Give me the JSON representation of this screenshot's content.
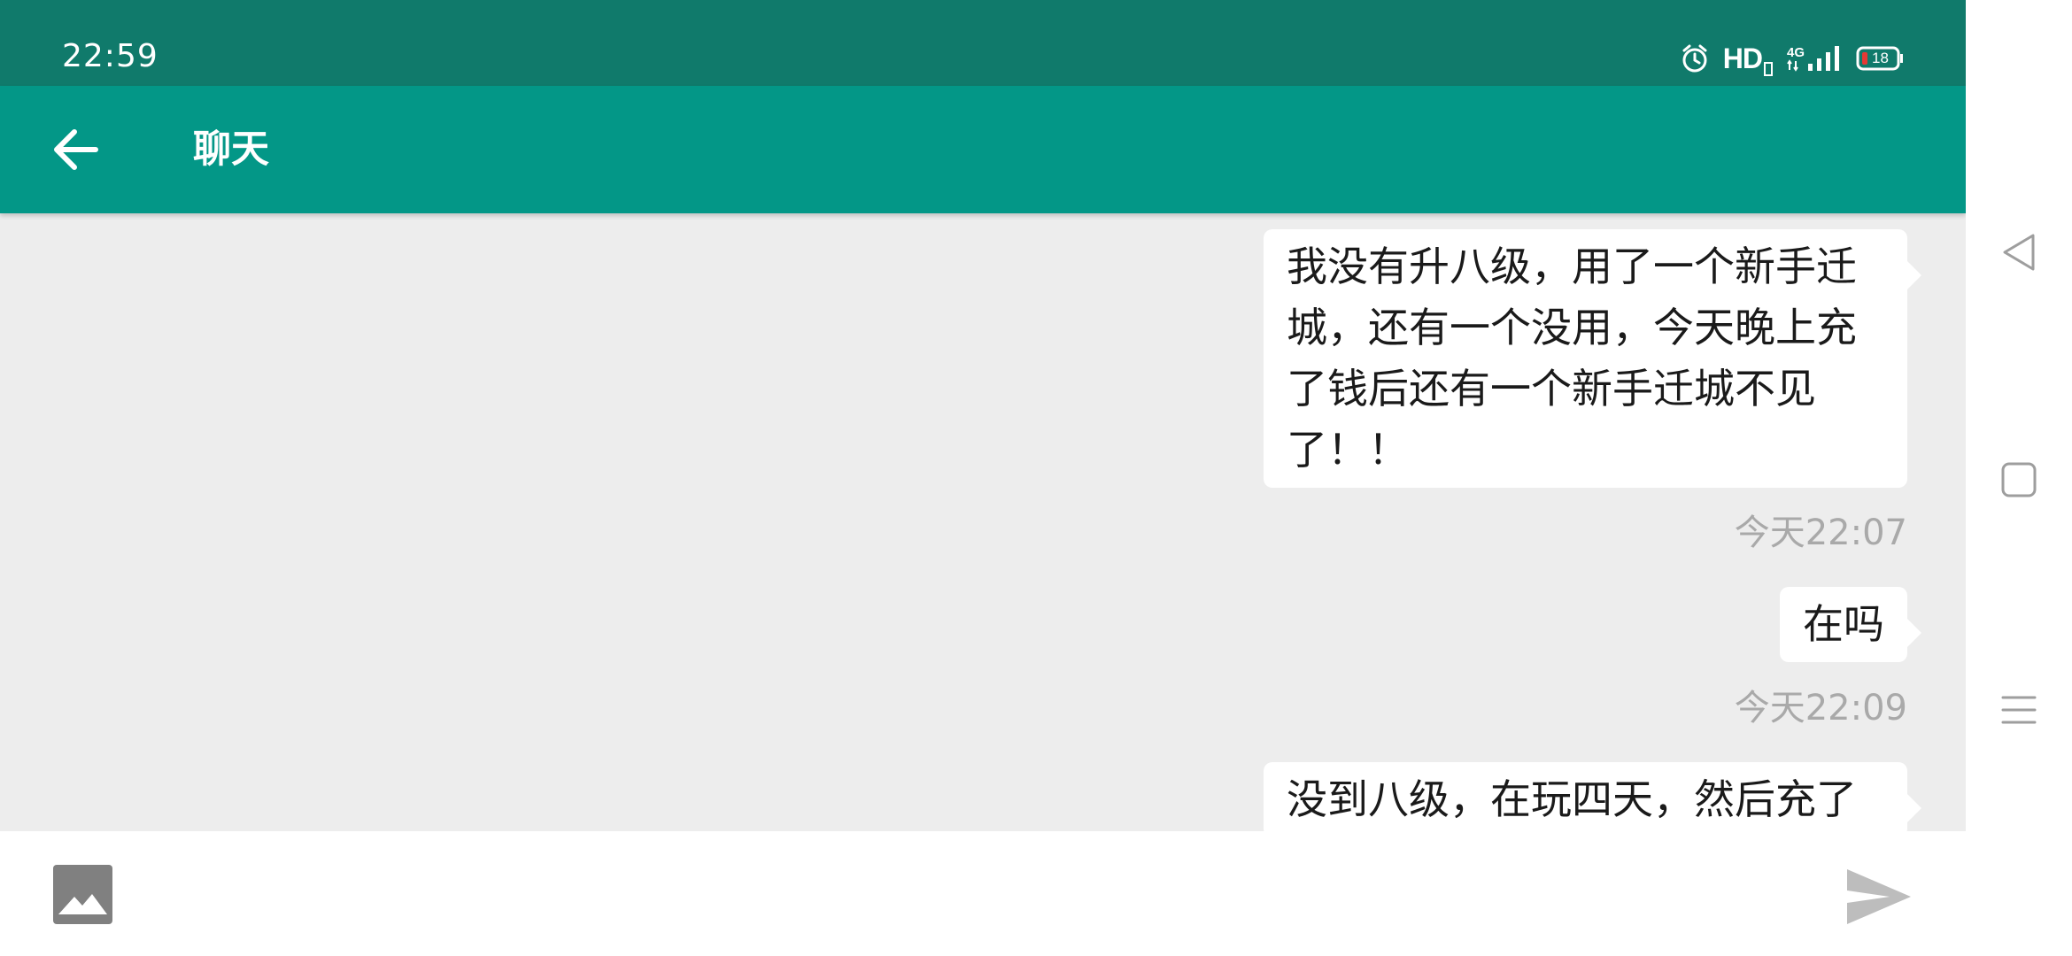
{
  "status_bar": {
    "time": "22:59",
    "hd": "HD",
    "network": "4G",
    "battery": "18",
    "icons": [
      "alarm-icon",
      "hd-icon",
      "signal-4g-icon",
      "battery-icon"
    ]
  },
  "app_bar": {
    "title": "聊天",
    "back_icon": "arrow-left-icon"
  },
  "messages": [
    {
      "text": "我没有升八级，用了一个新手迁城，还有一个没用，今天晚上充了钱后还有一个新手迁城不见了！！",
      "time": "今天22:07"
    },
    {
      "text": "在吗",
      "time": "今天22:09"
    },
    {
      "text": "没到八级，在玩四天，然后充了",
      "time": ""
    }
  ],
  "input_bar": {
    "placeholder": "",
    "value": "",
    "image_icon": "image-icon",
    "send_icon": "send-icon"
  },
  "system_nav": [
    "back-triangle-icon",
    "home-square-icon",
    "menu-lines-icon"
  ],
  "colors": {
    "status_bar": "#107a6b",
    "app_bar": "#039787",
    "chat_background": "#ededed",
    "bubble": "#ffffff",
    "timestamp": "#a9a9a9"
  }
}
